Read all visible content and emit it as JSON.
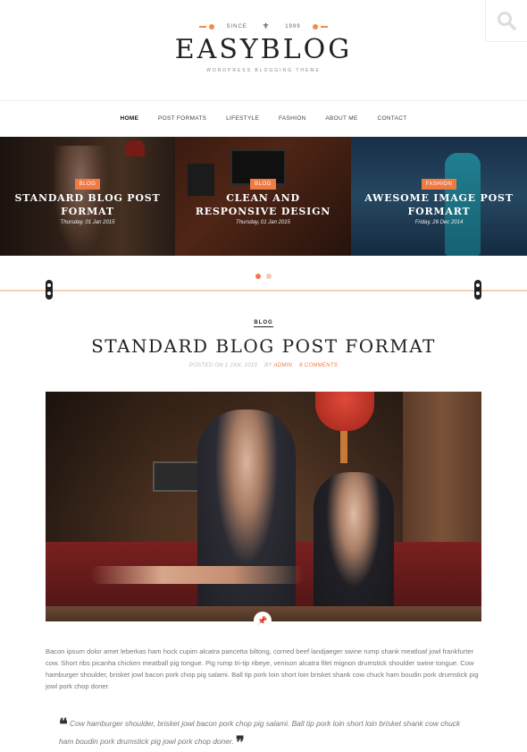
{
  "header": {
    "since_label": "SINCE",
    "since_year": "1999",
    "logo": "EASYBLOG",
    "tagline": "WORDPRESS BLOGGING THEME"
  },
  "search": {
    "icon": "search-icon"
  },
  "nav": {
    "items": [
      {
        "label": "HOME",
        "active": true
      },
      {
        "label": "POST FORMATS"
      },
      {
        "label": "LIFESTYLE"
      },
      {
        "label": "FASHION"
      },
      {
        "label": "ABOUT ME"
      },
      {
        "label": "CONTACT"
      }
    ]
  },
  "slider": {
    "slides": [
      {
        "tag": "BLOG",
        "title": "STANDARD BLOG POST FORMAT",
        "date": "Thursday, 01 Jan 2015"
      },
      {
        "tag": "BLOG",
        "title": "CLEAN AND RESPONSIVE DESIGN",
        "date": "Thursday, 01 Jan 2015"
      },
      {
        "tag": "FASHION",
        "title": "AWESOME IMAGE POST FORMART",
        "date": "Friday, 26 Dec 2014"
      }
    ],
    "active_index": 0
  },
  "post": {
    "category": "BLOG",
    "title": "STANDARD BLOG POST FORMAT",
    "meta_posted": "POSTED ON 1 JAN, 2015",
    "meta_by": "BY",
    "meta_author": "ADMIN",
    "meta_comments": "8 COMMENTS",
    "body": "Bacon ipsum dolor amet leberkas ham hock cupim alcatra pancetta biltong, corned beef landjaeger swine rump shank meatloaf jowl frankfurter cow. Short ribs picanha chicken meatball pig tongue. Pig rump tri-tip ribeye, venison alcatra filet mignon drumstick shoulder swine tongue. Cow hamburger shoulder, brisket jowl bacon pork chop pig salami. Ball tip pork loin short loin brisket shank cow chuck ham boudin pork drumstick pig jowl pork chop doner.",
    "quote": "Cow hamburger shoulder, brisket jowl bacon pork chop pig salami. Ball tip pork loin short loin brisket shank cow chuck ham boudin pork drumstick pig jowl pork chop doner."
  },
  "colors": {
    "accent": "#f07a44"
  }
}
